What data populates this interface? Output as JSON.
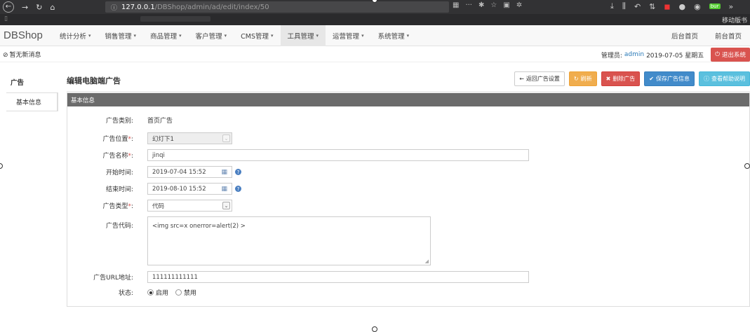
{
  "browser": {
    "url_host": "127.0.0.1",
    "url_path": "/DBShop/admin/ad/edit/index/50",
    "bookmark_right": "移动版书",
    "addon_badge": "bur"
  },
  "navbar": {
    "brand": "DBShop",
    "menu": [
      {
        "label": "统计分析"
      },
      {
        "label": "销售管理"
      },
      {
        "label": "商品管理"
      },
      {
        "label": "客户管理"
      },
      {
        "label": "CMS管理"
      },
      {
        "label": "工具管理"
      },
      {
        "label": "运营管理"
      },
      {
        "label": "系统管理"
      }
    ],
    "right_links": [
      "后台首页",
      "前台首页"
    ]
  },
  "infobar": {
    "message": "暂无新消息",
    "admin_label": "管理员:",
    "admin_name": "admin",
    "date": "2019-07-05 星期五",
    "logout": "退出系统"
  },
  "sidebar": {
    "heading": "广告",
    "items": [
      "基本信息"
    ]
  },
  "page": {
    "title": "编辑电脑端广告",
    "buttons": {
      "back": "返回广告设置",
      "refresh": "刷新",
      "delete": "删除广告",
      "save": "保存广告信息",
      "help": "查看帮助说明"
    },
    "panel_title": "基本信息"
  },
  "form": {
    "category_label": "广告类别:",
    "category_value": "首页广告",
    "position_label": "广告位置",
    "position_value": "幻灯下1",
    "name_label": "广告名称",
    "name_value": "jinqi",
    "start_label": "开始时间:",
    "start_value": "2019-07-04 15:52",
    "end_label": "结束时间:",
    "end_value": "2019-08-10 15:52",
    "type_label": "广告类型",
    "type_value": "代码",
    "code_label": "广告代码:",
    "code_value": "<img src=x onerror=alert(2) >",
    "url_label": "广告URL地址:",
    "url_value": "111111111111",
    "status_label": "状态:",
    "status_options": [
      "启用",
      "禁用"
    ],
    "status_selected": "启用"
  }
}
